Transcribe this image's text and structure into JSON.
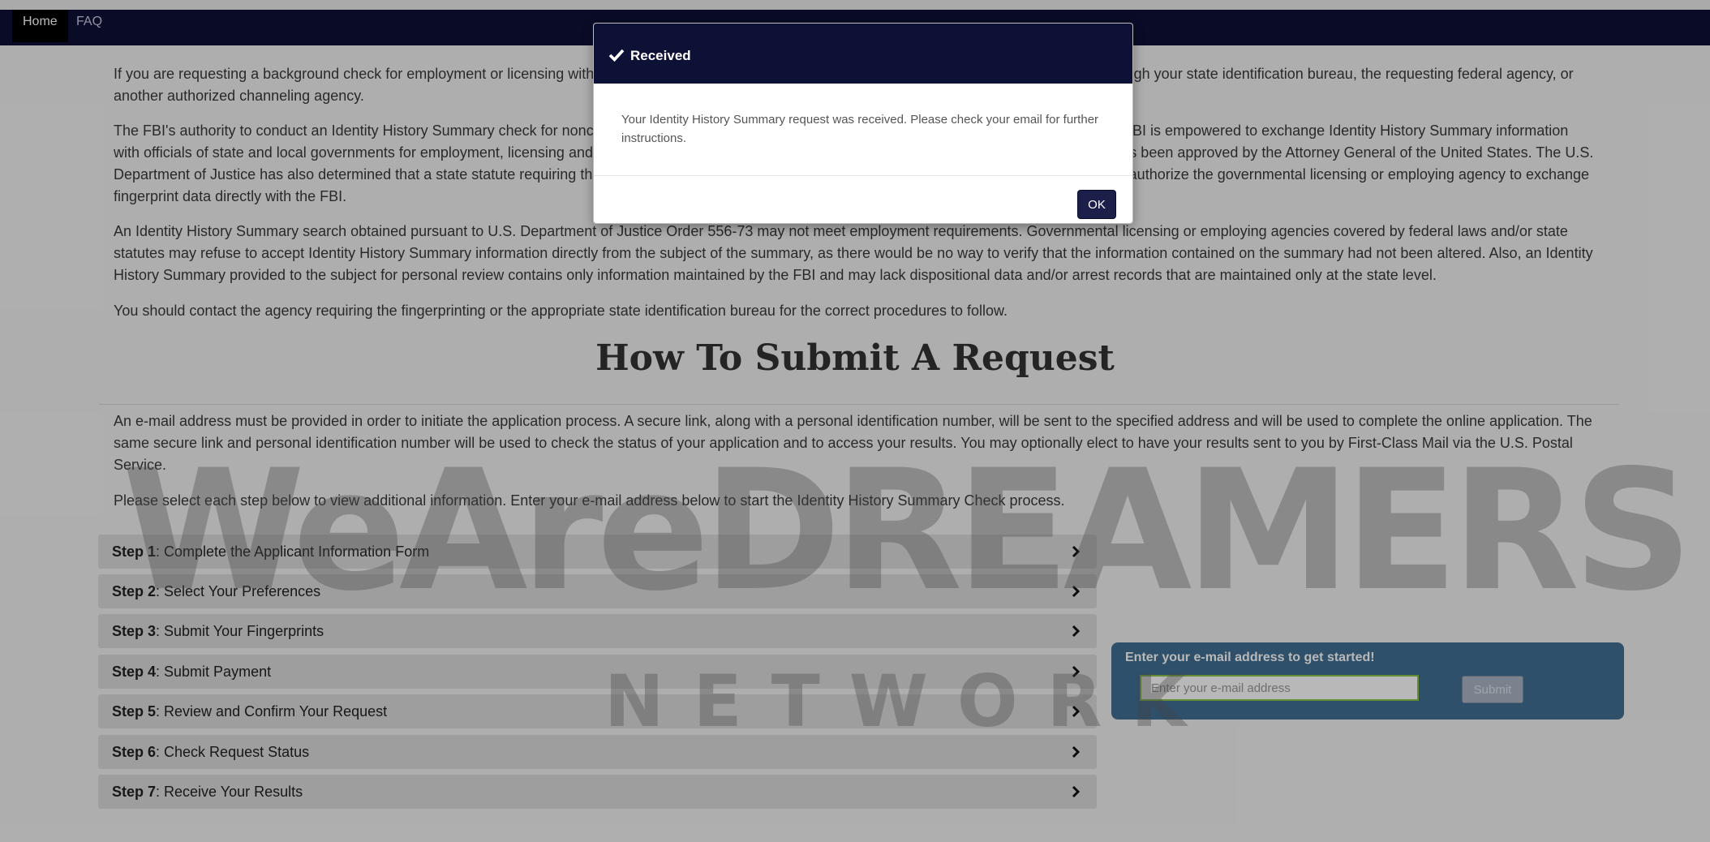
{
  "nav": {
    "items": [
      {
        "label": "Home",
        "active": true
      },
      {
        "label": "FAQ",
        "active": false
      }
    ]
  },
  "content": {
    "p1": "If you are requesting a background check for employment or licensing within the United States, you may be able to obtain your Identity History Summary through your state identification bureau, the requesting federal agency, or another authorized channeling agency.",
    "p2": "The FBI's authority to conduct an Identity History Summary check for noncriminal justice purposes is set forth in 28 CFR 16.30-16.34. Under federal law, the FBI is empowered to exchange Identity History Summary information with officials of state and local governments for employment, licensing and other similar noncriminal justice purposes, if authorized by a state statute which has been approved by the Attorney General of the United States. The U.S. Department of Justice has also determined that a state statute requiring the employment or the issuance of a license must, in itself, require fingerprinting and authorize the governmental licensing or employing agency to exchange fingerprint data directly with the FBI.",
    "p3": "An Identity History Summary search obtained pursuant to U.S. Department of Justice Order 556-73 may not meet employment requirements. Governmental licensing or employing agencies covered by federal laws and/or state statutes may refuse to accept Identity History Summary information directly from the subject of the summary, as there would be no way to verify that the information contained on the summary had not been altered. Also, an Identity History Summary provided to the subject for personal review contains only information maintained by the FBI and may lack dispositional data and/or arrest records that are maintained only at the state level.",
    "p4": "You should contact the agency requiring the fingerprinting or the appropriate state identification bureau for the correct procedures to follow.",
    "section_title": "How To Submit A Request",
    "p5": "An e-mail address must be provided in order to initiate the application process. A secure link, along with a personal identification number, will be sent to the specified address and will be used to complete the online application. The same secure link and personal identification number will be used to check the status of your application and to access your results. You may optionally elect to have your results sent to you by First-Class Mail via the U.S. Postal Service.",
    "p6": "Please select each step below to view additional information. Enter your e-mail address below to start the Identity History Summary Check process."
  },
  "steps": [
    {
      "num": "Step 1",
      "label": ": Complete the Applicant Information Form"
    },
    {
      "num": "Step 2",
      "label": ": Select Your Preferences"
    },
    {
      "num": "Step 3",
      "label": ": Submit Your Fingerprints"
    },
    {
      "num": "Step 4",
      "label": ": Submit Payment"
    },
    {
      "num": "Step 5",
      "label": ": Review and Confirm Your Request"
    },
    {
      "num": "Step 6",
      "label": ": Check Request Status"
    },
    {
      "num": "Step 7",
      "label": ": Receive Your Results"
    }
  ],
  "email_box": {
    "label": "Enter your e-mail address to get started!",
    "placeholder": "Enter your e-mail address",
    "submit_label": "Submit"
  },
  "watermark": {
    "line1": "WeAreDREAMERS",
    "line2": "NETWORK"
  },
  "modal": {
    "title": "Received",
    "icon": "check-icon",
    "message": "Your Identity History Summary request was received. Please check your email for further instructions.",
    "ok_label": "OK"
  },
  "colors": {
    "navbar": "#0e1136",
    "email_box": "#416f94",
    "email_input_border": "#8bc34a"
  }
}
